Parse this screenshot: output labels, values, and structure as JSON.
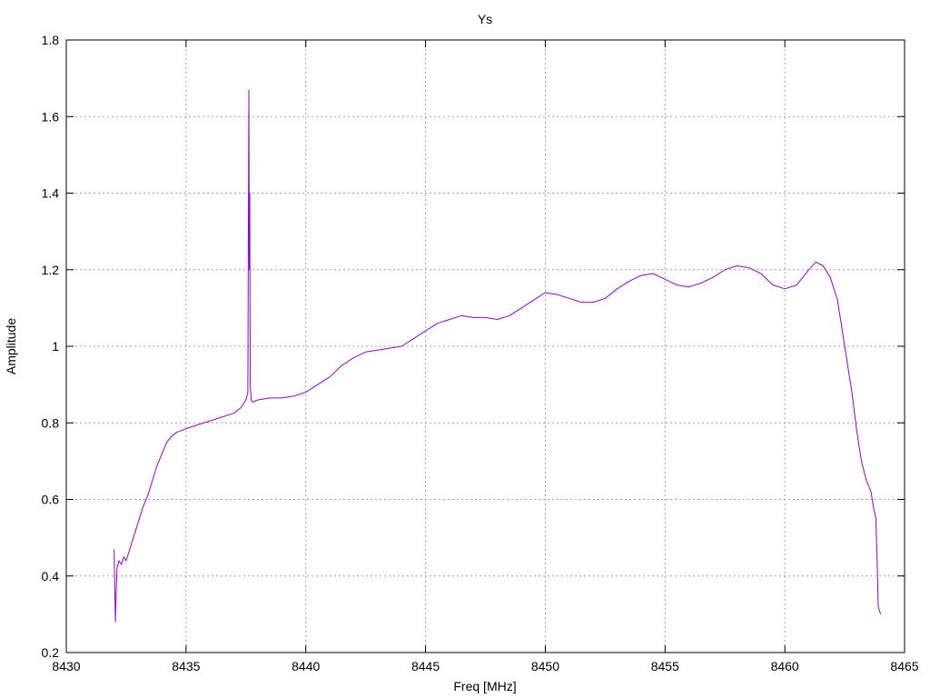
{
  "chart_data": {
    "type": "line",
    "title": "Ys",
    "xlabel": "Freq [MHz]",
    "ylabel": "Amplitude",
    "xlim": [
      8430,
      8465
    ],
    "ylim": [
      0.2,
      1.8
    ],
    "xticks": [
      8430,
      8435,
      8440,
      8445,
      8450,
      8455,
      8460,
      8465
    ],
    "yticks": [
      0.2,
      0.4,
      0.6,
      0.8,
      1.0,
      1.2,
      1.4,
      1.6,
      1.8
    ],
    "ytick_labels": [
      "0.2",
      "0.4",
      "0.6",
      "0.8",
      "1",
      "1.2",
      "1.4",
      "1.6",
      "1.8"
    ],
    "grid": true,
    "legend": "none",
    "series": [
      {
        "color": "#9400d3",
        "x": [
          8432.0,
          8432.02,
          8432.05,
          8432.08,
          8432.12,
          8432.2,
          8432.3,
          8432.4,
          8432.5,
          8432.6,
          8432.7,
          8432.8,
          8432.9,
          8433.0,
          8433.2,
          8433.4,
          8433.6,
          8433.8,
          8434.0,
          8434.2,
          8434.4,
          8434.6,
          8434.8,
          8435.0,
          8435.5,
          8436.0,
          8436.5,
          8437.0,
          8437.3,
          8437.5,
          8437.58,
          8437.62,
          8437.64,
          8437.66,
          8437.68,
          8437.7,
          8437.72,
          8437.76,
          8437.8,
          8438.0,
          8438.5,
          8439.0,
          8439.5,
          8440.0,
          8440.5,
          8441.0,
          8441.5,
          8442.0,
          8442.5,
          8443.0,
          8443.5,
          8444.0,
          8444.5,
          8445.0,
          8445.5,
          8446.0,
          8446.5,
          8447.0,
          8447.5,
          8448.0,
          8448.5,
          8449.0,
          8449.5,
          8450.0,
          8450.5,
          8451.0,
          8451.5,
          8452.0,
          8452.5,
          8453.0,
          8453.5,
          8454.0,
          8454.5,
          8455.0,
          8455.5,
          8456.0,
          8456.5,
          8457.0,
          8457.5,
          8458.0,
          8458.5,
          8459.0,
          8459.5,
          8460.0,
          8460.5,
          8461.0,
          8461.3,
          8461.6,
          8461.9,
          8462.2,
          8462.5,
          8462.8,
          8463.0,
          8463.2,
          8463.4,
          8463.6,
          8463.7,
          8463.8,
          8463.85,
          8463.9,
          8464.0
        ],
        "values": [
          0.47,
          0.38,
          0.28,
          0.36,
          0.42,
          0.44,
          0.43,
          0.45,
          0.44,
          0.46,
          0.48,
          0.5,
          0.52,
          0.54,
          0.58,
          0.61,
          0.65,
          0.69,
          0.72,
          0.75,
          0.765,
          0.775,
          0.78,
          0.785,
          0.795,
          0.805,
          0.815,
          0.825,
          0.84,
          0.86,
          0.88,
          1.67,
          1.2,
          1.4,
          0.9,
          0.88,
          0.86,
          0.855,
          0.855,
          0.86,
          0.865,
          0.865,
          0.87,
          0.88,
          0.9,
          0.92,
          0.95,
          0.97,
          0.985,
          0.99,
          0.995,
          1.0,
          1.02,
          1.04,
          1.06,
          1.07,
          1.08,
          1.075,
          1.075,
          1.07,
          1.08,
          1.1,
          1.12,
          1.14,
          1.135,
          1.125,
          1.115,
          1.115,
          1.125,
          1.15,
          1.17,
          1.185,
          1.19,
          1.175,
          1.16,
          1.155,
          1.165,
          1.18,
          1.2,
          1.21,
          1.205,
          1.19,
          1.16,
          1.15,
          1.16,
          1.2,
          1.22,
          1.21,
          1.18,
          1.12,
          1.0,
          0.88,
          0.78,
          0.7,
          0.65,
          0.62,
          0.58,
          0.55,
          0.45,
          0.32,
          0.3
        ]
      }
    ]
  }
}
